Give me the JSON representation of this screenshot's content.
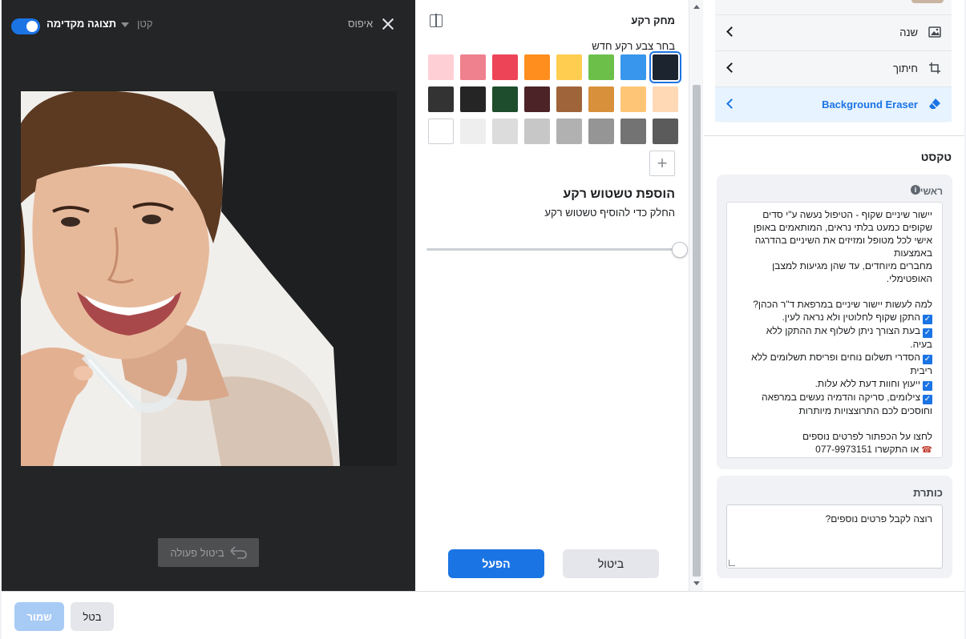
{
  "preview": {
    "toggle_label": "תצוגה מקדימה",
    "size_label": "קטן",
    "reset_label": "איפוס",
    "undo_label": "ביטול פעולה",
    "toggle_on": true
  },
  "eraser": {
    "title": "מחק רקע",
    "pick_color_label": "בחר צבע רקע חדש",
    "colors": [
      "#1c2430",
      "#3897ec",
      "#6cc04a",
      "#ffcd50",
      "#ff8e1f",
      "#ee4458",
      "#ef808d",
      "#ffcfd6",
      "#ffd9b5",
      "#ffc577",
      "#d8903b",
      "#a0643a",
      "#4c2327",
      "#1d4d2c",
      "#252525",
      "#333333",
      "#5b5b5b",
      "#737373",
      "#959595",
      "#b1b1b1",
      "#c7c7c7",
      "#dcdcdc",
      "#eeeeee",
      "#ffffff"
    ],
    "selected_color_index": 0,
    "add_color_symbol": "+",
    "blur_title": "הוספת טשטוש רקע",
    "blur_subtitle": "החלק כדי להוסיף טשטוש רקע",
    "blur_level": 1.0,
    "cancel_label": "ביטול",
    "apply_label": "הפעל"
  },
  "tools": {
    "items": [
      {
        "label": "שנה",
        "icon": "image-icon"
      },
      {
        "label": "חיתוך",
        "icon": "crop-icon"
      },
      {
        "label": "Background Eraser",
        "icon": "eraser-icon",
        "active": true
      }
    ]
  },
  "text_section": {
    "heading": "טקסט",
    "primary_label": "ראשי",
    "primary_lines": [
      "יישור שיניים שקוף - הטיפול נעשה ע\"י סדים",
      "שקופים כמעט בלתי נראים, המותאמים באופן",
      "אישי לכל מטופל ומזיזים את השיניים בהדרגה",
      "באמצעות",
      "מחברים מיוחדים, עד שהן מגיעות למצבן",
      "האופטימלי.",
      "",
      "למה לעשות יישור שיניים במרפאת ד\"ר הכהן?",
      "התקן שקוף לחלוטין ולא נראה לעין.",
      "בעת הצורך ניתן לשלוף את ההתקן ללא",
      "בעיה.",
      "הסדרי תשלום נוחים ופריסת תשלומים ללא",
      "ריבית",
      "ייעוץ וחוות דעת ללא עלות.",
      "צילומים, סריקה והדמיה נעשים במרפאה",
      "וחוסכים לכם התרוצצויות מיותרות",
      "",
      "לחצו על הכפתור לפרטים נוספים",
      "או התקשרו 077-9973151"
    ],
    "checked_line_indices": [
      8,
      9,
      11,
      13,
      14
    ],
    "headline_label": "כותרת",
    "headline_value": "רוצה לקבל פרטים נוספים?"
  },
  "footer": {
    "save_label": "שמור",
    "discard_label": "בטל"
  },
  "colors": {
    "accent": "#1b74e4",
    "preview_bg": "#242526",
    "active_row_bg": "#e7f3ff"
  }
}
